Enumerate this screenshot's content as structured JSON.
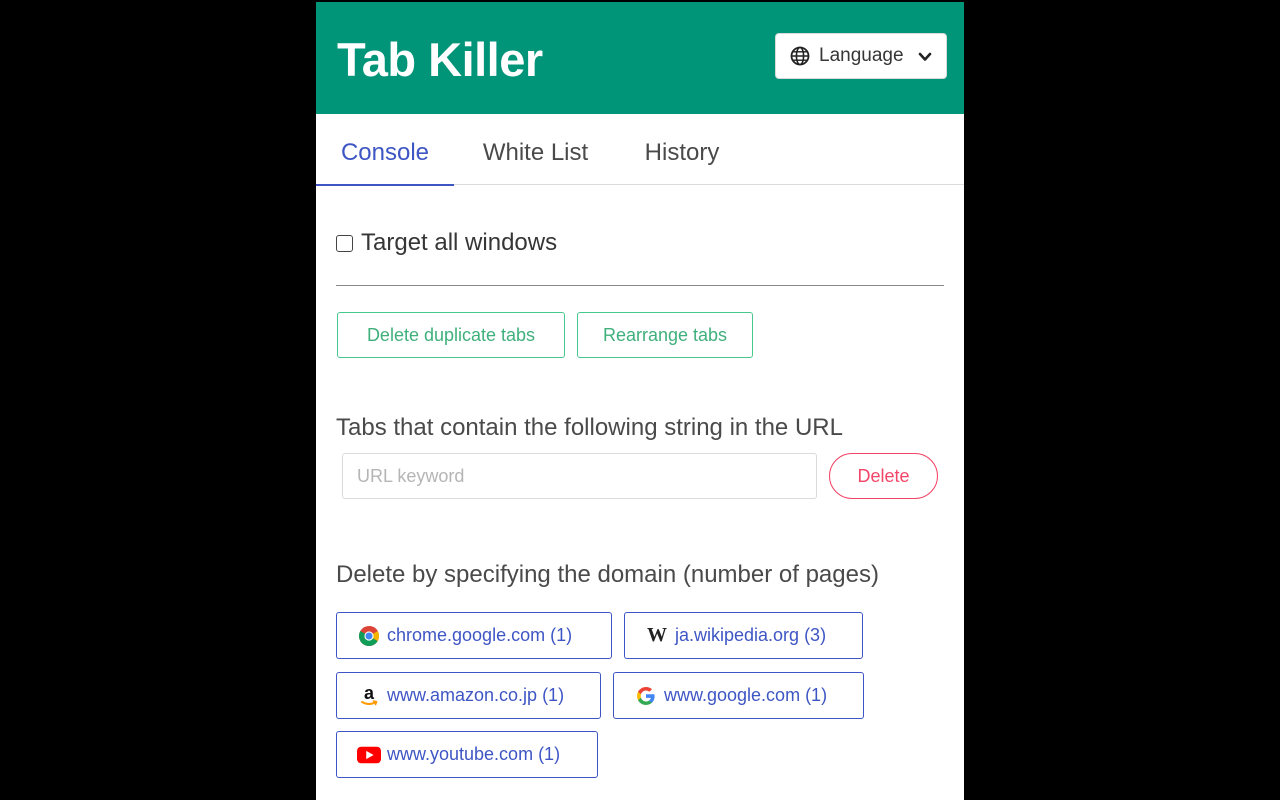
{
  "app": {
    "title": "Tab Killer"
  },
  "language": {
    "label": "Language"
  },
  "tabs": [
    {
      "label": "Console",
      "active": true
    },
    {
      "label": "White List",
      "active": false
    },
    {
      "label": "History",
      "active": false
    }
  ],
  "console": {
    "target_all_windows": {
      "label": "Target all windows",
      "checked": false
    },
    "delete_duplicate_label": "Delete duplicate tabs",
    "rearrange_label": "Rearrange tabs",
    "url_section_label": "Tabs that contain the following string in the URL",
    "url_input": {
      "placeholder": "URL keyword",
      "value": ""
    },
    "url_delete_label": "Delete",
    "domain_section_label": "Delete by specifying the domain (number of pages)",
    "domains": [
      {
        "label": "chrome.google.com (1)",
        "icon": "chrome-icon"
      },
      {
        "label": "ja.wikipedia.org (3)",
        "icon": "wikipedia-icon"
      },
      {
        "label": "www.amazon.co.jp (1)",
        "icon": "amazon-icon"
      },
      {
        "label": "www.google.com (1)",
        "icon": "google-icon"
      },
      {
        "label": "www.youtube.com (1)",
        "icon": "youtube-icon"
      }
    ]
  },
  "colors": {
    "header": "#009479",
    "accent": "#3e56c4",
    "success": "#48c78e",
    "danger": "#f14668"
  }
}
